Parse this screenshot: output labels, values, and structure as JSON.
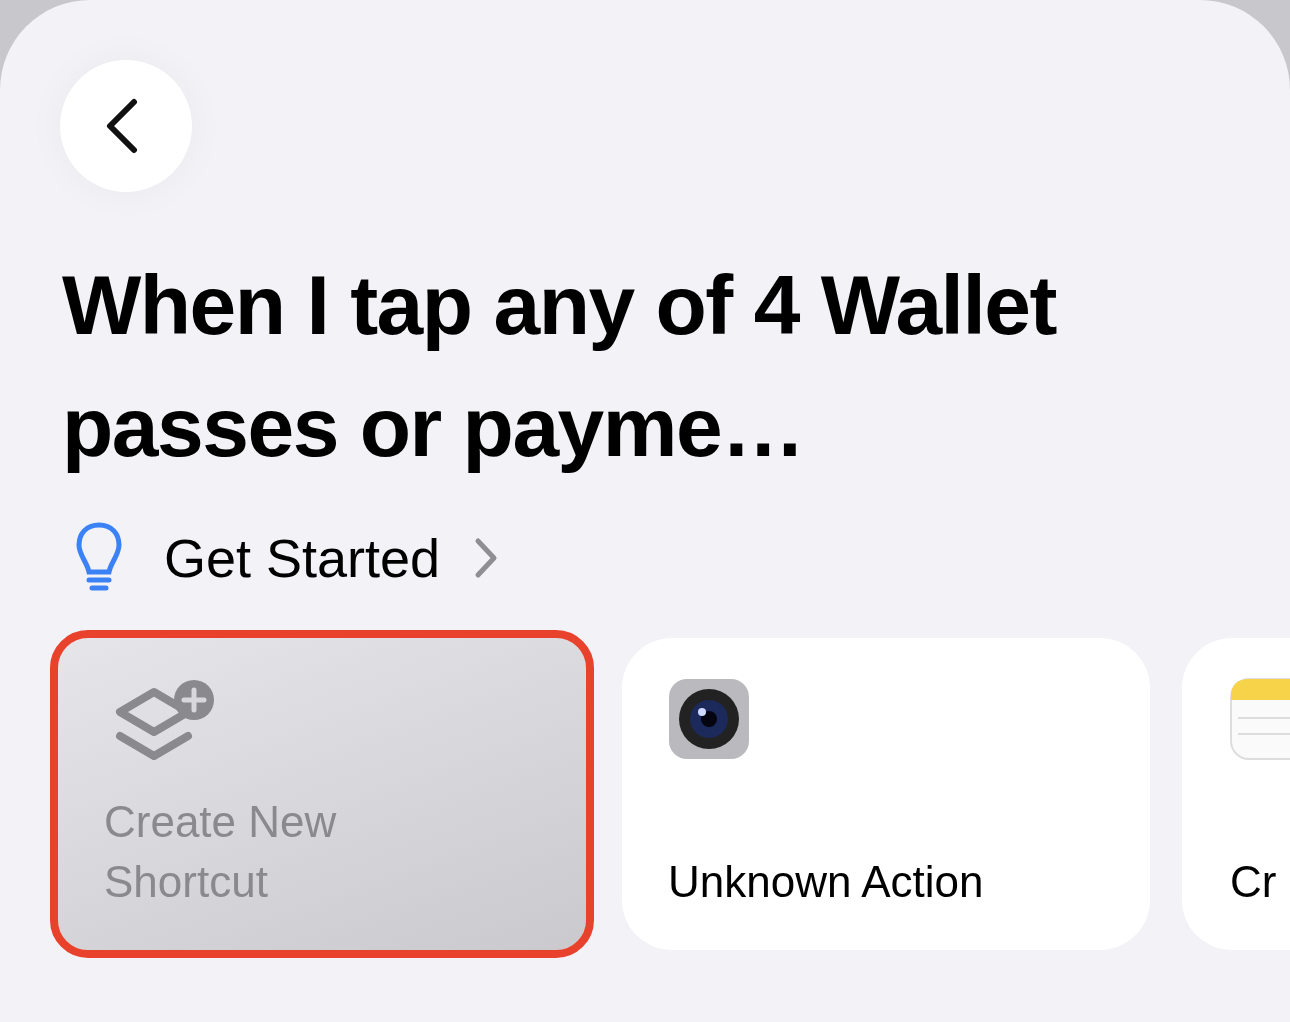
{
  "title": "When I tap any of 4 Wallet passes or payme…",
  "get_started": {
    "label": "Get Started"
  },
  "cards": [
    {
      "kind": "create",
      "label": "Create New Shortcut",
      "selected": true
    },
    {
      "kind": "camera",
      "label": "Unknown Action",
      "selected": false
    },
    {
      "kind": "notes",
      "label": "Cr",
      "selected": false
    }
  ]
}
